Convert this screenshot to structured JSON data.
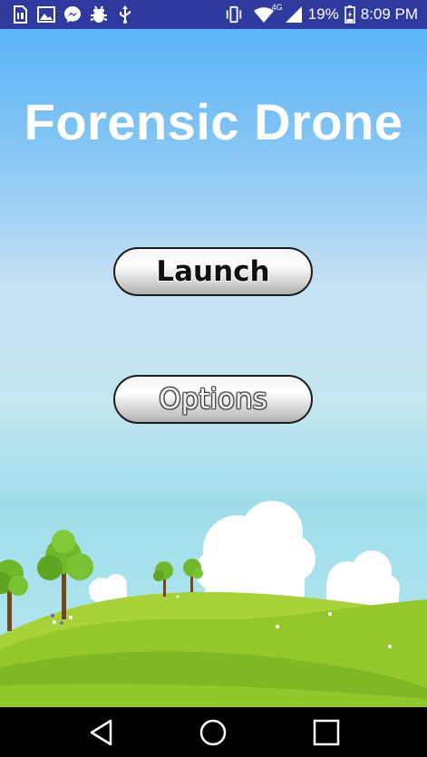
{
  "status_bar": {
    "left_icons": [
      "sim-id-icon",
      "gallery-icon",
      "messenger-icon",
      "bug-icon",
      "usb-icon"
    ],
    "right_icons": [
      "vibrate-icon",
      "wifi-icon",
      "signal-icon",
      "battery-icon"
    ],
    "network_label": "4G",
    "battery_percent": "19%",
    "time": "8:09 PM"
  },
  "app": {
    "title": "Forensic Drone",
    "launch_label": "Launch",
    "options_label": "Options"
  },
  "nav_bar": {
    "buttons": [
      "back-icon",
      "home-icon",
      "recent-apps-icon"
    ]
  },
  "colors": {
    "status_bar": "#2f3a9e",
    "sky_top": "#5ab4f8",
    "sky_bottom": "#b8e6ee",
    "grass": "#8ec82a",
    "title": "#ffffff"
  }
}
